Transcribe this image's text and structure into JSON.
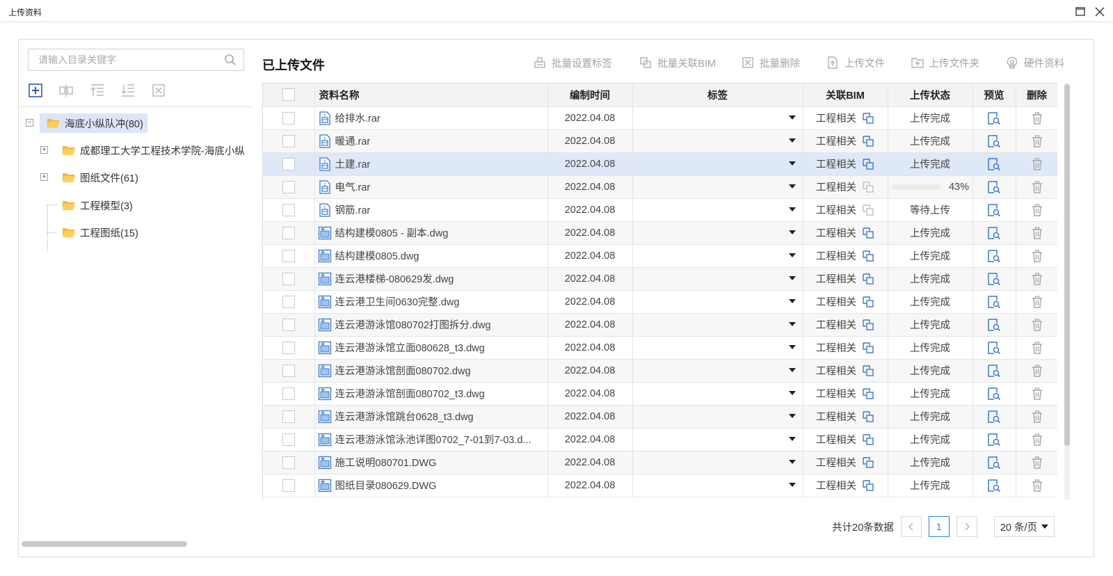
{
  "window": {
    "title": "上传资料"
  },
  "left": {
    "search_placeholder": "请输入目录关键字",
    "tree": {
      "root": "海底小纵队冲(80)",
      "children": [
        {
          "label": "成都理工大学工程技术学院-海底小纵",
          "expandable": true
        },
        {
          "label": "图纸文件(61)",
          "expandable": true
        },
        {
          "label": "工程模型(3)",
          "expandable": false
        },
        {
          "label": "工程图纸(15)",
          "expandable": false
        }
      ]
    }
  },
  "right": {
    "title": "已上传文件",
    "actions": {
      "batch_tag": "批量设置标签",
      "batch_bim": "批量关联BIM",
      "batch_delete": "批量删除",
      "upload_file": "上传文件",
      "upload_folder": "上传文件夹",
      "hardware": "硬件资料"
    },
    "columns": {
      "name": "资料名称",
      "time": "编制时间",
      "tag": "标签",
      "bim": "关联BIM",
      "status": "上传状态",
      "preview": "预览",
      "delete": "删除"
    },
    "rows": [
      {
        "name": "给排水.rar",
        "time": "2022.04.08",
        "bim": "工程相关",
        "status": "上传完成",
        "type": "rar",
        "bim_active": true
      },
      {
        "name": "暖通.rar",
        "time": "2022.04.08",
        "bim": "工程相关",
        "status": "上传完成",
        "type": "rar",
        "bim_active": true
      },
      {
        "name": "土建.rar",
        "time": "2022.04.08",
        "bim": "工程相关",
        "status": "上传完成",
        "type": "rar",
        "bim_active": true
      },
      {
        "name": "电气.rar",
        "time": "2022.04.08",
        "bim": "工程相关",
        "status": "",
        "progress": 0.43,
        "progress_text": "43%",
        "type": "rar",
        "bim_active": false
      },
      {
        "name": "钢筋.rar",
        "time": "2022.04.08",
        "bim": "工程相关",
        "status": "等待上传",
        "type": "rar",
        "bim_active": false
      },
      {
        "name": "结构建模0805 - 副本.dwg",
        "time": "2022.04.08",
        "bim": "工程相关",
        "status": "上传完成",
        "type": "dwg",
        "bim_active": true
      },
      {
        "name": "结构建模0805.dwg",
        "time": "2022.04.08",
        "bim": "工程相关",
        "status": "上传完成",
        "type": "dwg",
        "bim_active": true
      },
      {
        "name": "连云港楼梯-080629发.dwg",
        "time": "2022.04.08",
        "bim": "工程相关",
        "status": "上传完成",
        "type": "dwg",
        "bim_active": true
      },
      {
        "name": "连云港卫生间0630完整.dwg",
        "time": "2022.04.08",
        "bim": "工程相关",
        "status": "上传完成",
        "type": "dwg",
        "bim_active": true
      },
      {
        "name": "连云港游泳馆080702打图拆分.dwg",
        "time": "2022.04.08",
        "bim": "工程相关",
        "status": "上传完成",
        "type": "dwg",
        "bim_active": true
      },
      {
        "name": "连云港游泳馆立面080628_t3.dwg",
        "time": "2022.04.08",
        "bim": "工程相关",
        "status": "上传完成",
        "type": "dwg",
        "bim_active": true
      },
      {
        "name": "连云港游泳馆剖面080702.dwg",
        "time": "2022.04.08",
        "bim": "工程相关",
        "status": "上传完成",
        "type": "dwg",
        "bim_active": true
      },
      {
        "name": "连云港游泳馆剖面080702_t3.dwg",
        "time": "2022.04.08",
        "bim": "工程相关",
        "status": "上传完成",
        "type": "dwg",
        "bim_active": true
      },
      {
        "name": "连云港游泳馆跳台0628_t3.dwg",
        "time": "2022.04.08",
        "bim": "工程相关",
        "status": "上传完成",
        "type": "dwg",
        "bim_active": true
      },
      {
        "name": "连云港游泳馆泳池详图0702_7-01到7-03.d...",
        "time": "2022.04.08",
        "bim": "工程相关",
        "status": "上传完成",
        "type": "dwg",
        "bim_active": true
      },
      {
        "name": "施工说明080701.DWG",
        "time": "2022.04.08",
        "bim": "工程相关",
        "status": "上传完成",
        "type": "dwg",
        "bim_active": true
      },
      {
        "name": "图纸目录080629.DWG",
        "time": "2022.04.08",
        "bim": "工程相关",
        "status": "上传完成",
        "type": "dwg",
        "bim_active": true
      }
    ],
    "selected_row": 2,
    "pagination": {
      "total": "共计20条数据",
      "page": "1",
      "page_size": "20 条/页"
    }
  },
  "colors": {
    "accent": "#1e88e5",
    "selected_row": "#dfe8f7",
    "icon_blue": "#3a78c9",
    "disabled": "#a3a3a3"
  }
}
